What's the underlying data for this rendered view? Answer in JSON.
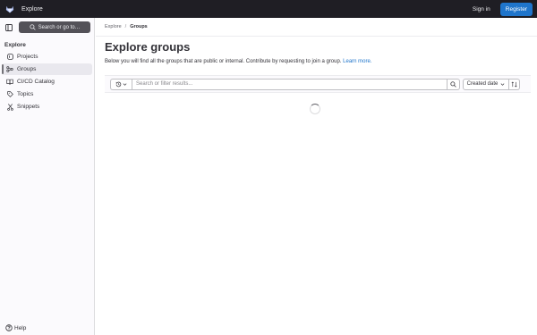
{
  "topbar": {
    "title": "Explore",
    "sign_in_label": "Sign in",
    "register_label": "Register",
    "brand_color": "#1f75cb"
  },
  "sidebar": {
    "search_label": "Search or go to…",
    "section_title": "Explore",
    "items": [
      {
        "label": "Projects",
        "icon": "project-icon"
      },
      {
        "label": "Groups",
        "icon": "group-icon",
        "active": true
      },
      {
        "label": "CI/CD Catalog",
        "icon": "catalog-icon"
      },
      {
        "label": "Topics",
        "icon": "label-icon"
      },
      {
        "label": "Snippets",
        "icon": "snippet-icon"
      }
    ],
    "help_label": "Help"
  },
  "breadcrumb": {
    "items": [
      "Explore",
      "Groups"
    ],
    "separator": "/"
  },
  "page": {
    "title": "Explore groups",
    "description": "Below you will find all the groups that are public or internal. Contribute by requesting to join a group.",
    "learn_more": "Learn more."
  },
  "filter": {
    "placeholder": "Search or filter results...",
    "sort_label": "Created date"
  }
}
